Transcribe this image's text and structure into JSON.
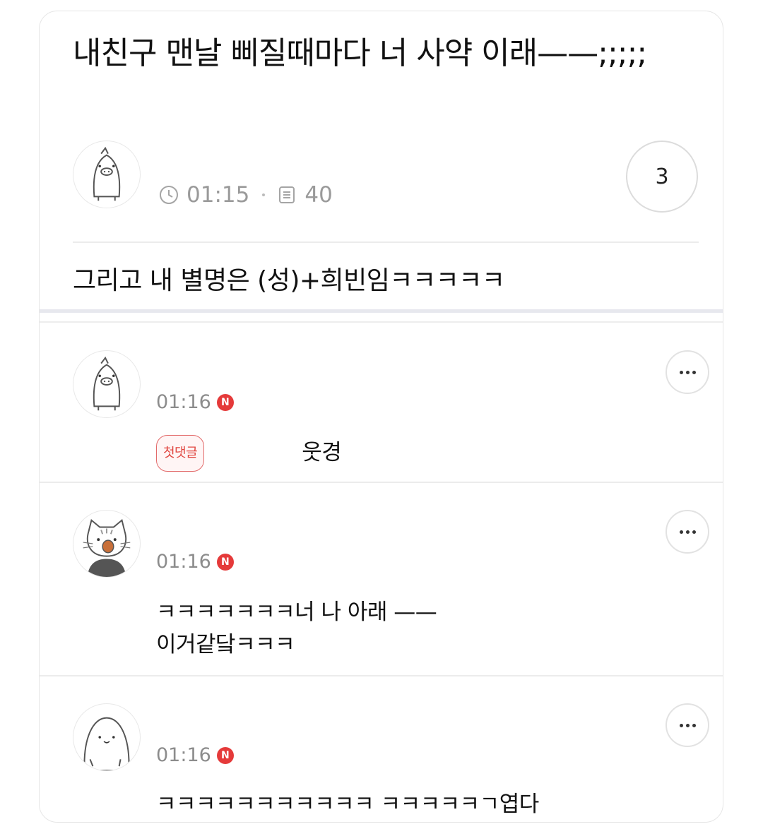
{
  "post": {
    "title": "내친구 맨날 삐질때마다 너 사약 이래——;;;;;",
    "time": "01:15",
    "views": "40",
    "comment_count": "3",
    "body": "그리고 내 별명은 (성)+희빈임ㅋㅋㅋㅋㅋ"
  },
  "comments": [
    {
      "time": "01:16",
      "badge": "N",
      "first_label": "첫댓글",
      "text": "웃경",
      "avatar": "penguin-avatar"
    },
    {
      "time": "01:16",
      "badge": "N",
      "text_line1": "ㅋㅋㅋㅋㅋㅋㅋ너 나 아래 ——",
      "text_line2": "이거같닼ㅋㅋㅋ",
      "avatar": "cat-avatar"
    },
    {
      "time": "01:16",
      "badge": "N",
      "text": "ㅋㅋㅋㅋㅋㅋㅋㅋㅋㅋㅋ ㅋㅋㅋㅋㅋㄱ엽다",
      "avatar": "seal-avatar"
    }
  ],
  "icons": {
    "clock": "clock-icon",
    "views": "document-icon",
    "more": "more-dots-icon"
  },
  "colors": {
    "new_badge": "#e53a3a",
    "first_badge": "#e0453f",
    "meta_text": "#9a9a9a"
  }
}
